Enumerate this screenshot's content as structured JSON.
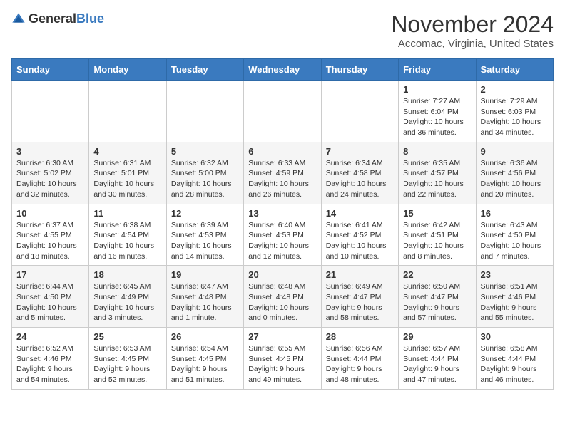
{
  "logo": {
    "text_general": "General",
    "text_blue": "Blue"
  },
  "title": "November 2024",
  "subtitle": "Accomac, Virginia, United States",
  "days_of_week": [
    "Sunday",
    "Monday",
    "Tuesday",
    "Wednesday",
    "Thursday",
    "Friday",
    "Saturday"
  ],
  "weeks": [
    [
      {
        "day": "",
        "info": ""
      },
      {
        "day": "",
        "info": ""
      },
      {
        "day": "",
        "info": ""
      },
      {
        "day": "",
        "info": ""
      },
      {
        "day": "",
        "info": ""
      },
      {
        "day": "1",
        "info": "Sunrise: 7:27 AM\nSunset: 6:04 PM\nDaylight: 10 hours and 36 minutes."
      },
      {
        "day": "2",
        "info": "Sunrise: 7:29 AM\nSunset: 6:03 PM\nDaylight: 10 hours and 34 minutes."
      }
    ],
    [
      {
        "day": "3",
        "info": "Sunrise: 6:30 AM\nSunset: 5:02 PM\nDaylight: 10 hours and 32 minutes."
      },
      {
        "day": "4",
        "info": "Sunrise: 6:31 AM\nSunset: 5:01 PM\nDaylight: 10 hours and 30 minutes."
      },
      {
        "day": "5",
        "info": "Sunrise: 6:32 AM\nSunset: 5:00 PM\nDaylight: 10 hours and 28 minutes."
      },
      {
        "day": "6",
        "info": "Sunrise: 6:33 AM\nSunset: 4:59 PM\nDaylight: 10 hours and 26 minutes."
      },
      {
        "day": "7",
        "info": "Sunrise: 6:34 AM\nSunset: 4:58 PM\nDaylight: 10 hours and 24 minutes."
      },
      {
        "day": "8",
        "info": "Sunrise: 6:35 AM\nSunset: 4:57 PM\nDaylight: 10 hours and 22 minutes."
      },
      {
        "day": "9",
        "info": "Sunrise: 6:36 AM\nSunset: 4:56 PM\nDaylight: 10 hours and 20 minutes."
      }
    ],
    [
      {
        "day": "10",
        "info": "Sunrise: 6:37 AM\nSunset: 4:55 PM\nDaylight: 10 hours and 18 minutes."
      },
      {
        "day": "11",
        "info": "Sunrise: 6:38 AM\nSunset: 4:54 PM\nDaylight: 10 hours and 16 minutes."
      },
      {
        "day": "12",
        "info": "Sunrise: 6:39 AM\nSunset: 4:53 PM\nDaylight: 10 hours and 14 minutes."
      },
      {
        "day": "13",
        "info": "Sunrise: 6:40 AM\nSunset: 4:53 PM\nDaylight: 10 hours and 12 minutes."
      },
      {
        "day": "14",
        "info": "Sunrise: 6:41 AM\nSunset: 4:52 PM\nDaylight: 10 hours and 10 minutes."
      },
      {
        "day": "15",
        "info": "Sunrise: 6:42 AM\nSunset: 4:51 PM\nDaylight: 10 hours and 8 minutes."
      },
      {
        "day": "16",
        "info": "Sunrise: 6:43 AM\nSunset: 4:50 PM\nDaylight: 10 hours and 7 minutes."
      }
    ],
    [
      {
        "day": "17",
        "info": "Sunrise: 6:44 AM\nSunset: 4:50 PM\nDaylight: 10 hours and 5 minutes."
      },
      {
        "day": "18",
        "info": "Sunrise: 6:45 AM\nSunset: 4:49 PM\nDaylight: 10 hours and 3 minutes."
      },
      {
        "day": "19",
        "info": "Sunrise: 6:47 AM\nSunset: 4:48 PM\nDaylight: 10 hours and 1 minute."
      },
      {
        "day": "20",
        "info": "Sunrise: 6:48 AM\nSunset: 4:48 PM\nDaylight: 10 hours and 0 minutes."
      },
      {
        "day": "21",
        "info": "Sunrise: 6:49 AM\nSunset: 4:47 PM\nDaylight: 9 hours and 58 minutes."
      },
      {
        "day": "22",
        "info": "Sunrise: 6:50 AM\nSunset: 4:47 PM\nDaylight: 9 hours and 57 minutes."
      },
      {
        "day": "23",
        "info": "Sunrise: 6:51 AM\nSunset: 4:46 PM\nDaylight: 9 hours and 55 minutes."
      }
    ],
    [
      {
        "day": "24",
        "info": "Sunrise: 6:52 AM\nSunset: 4:46 PM\nDaylight: 9 hours and 54 minutes."
      },
      {
        "day": "25",
        "info": "Sunrise: 6:53 AM\nSunset: 4:45 PM\nDaylight: 9 hours and 52 minutes."
      },
      {
        "day": "26",
        "info": "Sunrise: 6:54 AM\nSunset: 4:45 PM\nDaylight: 9 hours and 51 minutes."
      },
      {
        "day": "27",
        "info": "Sunrise: 6:55 AM\nSunset: 4:45 PM\nDaylight: 9 hours and 49 minutes."
      },
      {
        "day": "28",
        "info": "Sunrise: 6:56 AM\nSunset: 4:44 PM\nDaylight: 9 hours and 48 minutes."
      },
      {
        "day": "29",
        "info": "Sunrise: 6:57 AM\nSunset: 4:44 PM\nDaylight: 9 hours and 47 minutes."
      },
      {
        "day": "30",
        "info": "Sunrise: 6:58 AM\nSunset: 4:44 PM\nDaylight: 9 hours and 46 minutes."
      }
    ]
  ]
}
